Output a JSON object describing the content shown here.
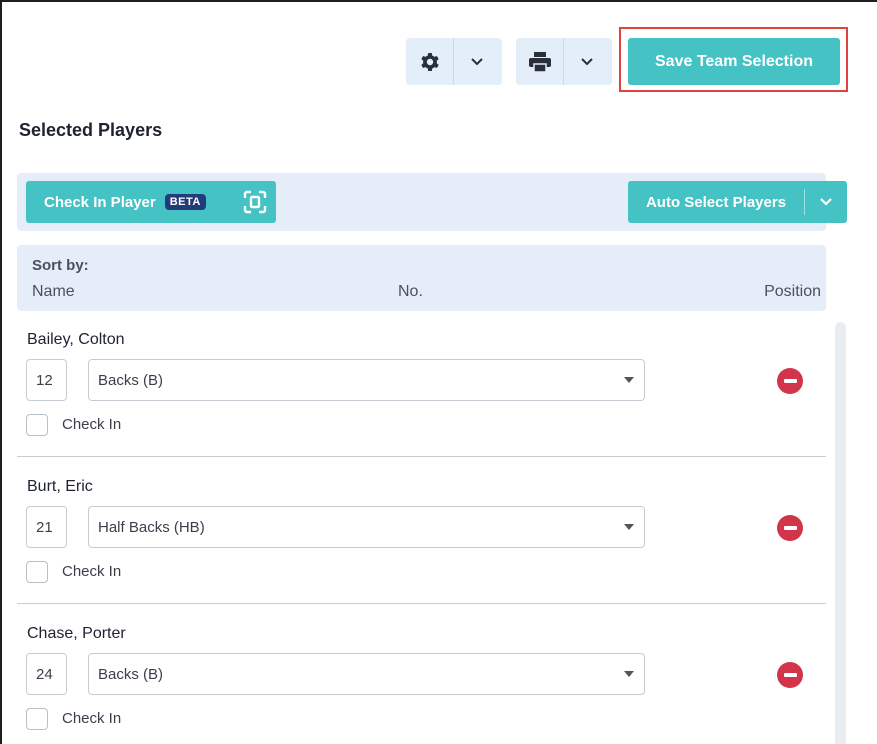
{
  "toolbar": {
    "settings_icon": "gear-icon",
    "print_icon": "printer-icon",
    "save_label": "Save Team Selection"
  },
  "section_title": "Selected Players",
  "actions": {
    "checkin_label": "Check In Player",
    "beta_badge": "BETA",
    "auto_select_label": "Auto Select Players"
  },
  "sort": {
    "label": "Sort by:",
    "columns": [
      "Name",
      "No.",
      "Position"
    ]
  },
  "players": [
    {
      "name": "Bailey, Colton",
      "number": "12",
      "position": "Backs (B)",
      "checkin_label": "Check In"
    },
    {
      "name": "Burt, Eric",
      "number": "21",
      "position": "Half Backs (HB)",
      "checkin_label": "Check In"
    },
    {
      "name": "Chase, Porter",
      "number": "24",
      "position": "Backs (B)",
      "checkin_label": "Check In"
    }
  ],
  "colors": {
    "accent": "#45c2c4",
    "toolbar_bg": "#e3eef8",
    "highlight": "#e0433d",
    "remove": "#d2344a",
    "badge": "#233b7a"
  }
}
